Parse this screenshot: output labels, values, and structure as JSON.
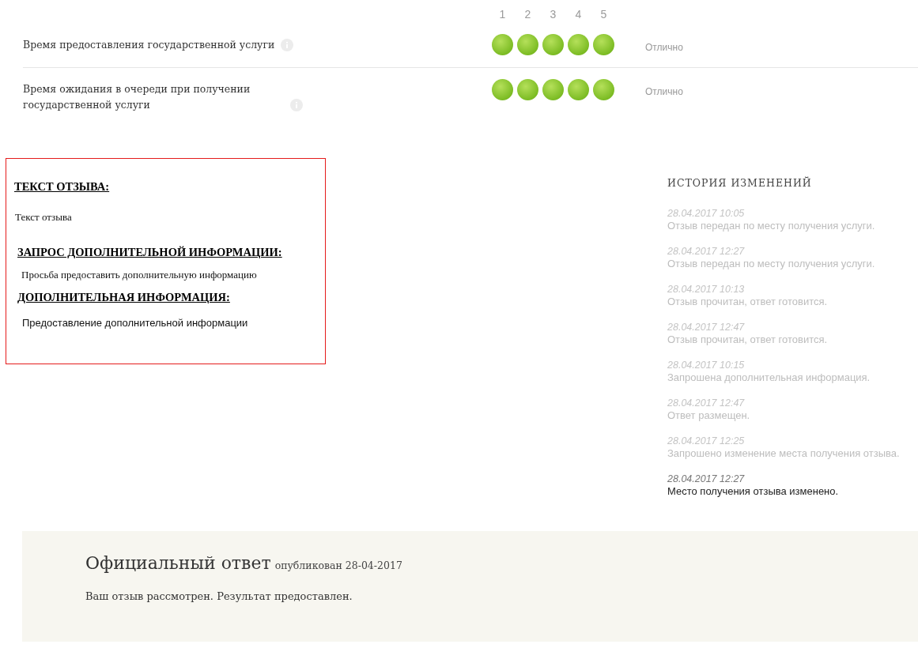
{
  "scale": [
    "1",
    "2",
    "3",
    "4",
    "5"
  ],
  "ratings": [
    {
      "label": "Время предоставления государственной услуги",
      "stars": 5,
      "verdict": "Отлично"
    },
    {
      "label": "Время ожидания в очереди при получении государственной услуги",
      "stars": 5,
      "verdict": "Отлично"
    }
  ],
  "review": {
    "sections": [
      {
        "heading": "ТЕКСТ ОТЗЫВА:",
        "body": "Текст отзыва",
        "kind": "serif"
      },
      {
        "heading": "ЗАПРОС ДОПОЛНИТЕЛЬНОЙ ИНФОРМАЦИИ:",
        "body": "Просьба предоставить дополнительную информацию",
        "kind": "serif"
      },
      {
        "heading": "ДОПОЛНИТЕЛЬНАЯ ИНФОРМАЦИЯ:",
        "body": "Предоставление дополнительной информации",
        "kind": "sans"
      }
    ]
  },
  "history": {
    "title": "ИСТОРИЯ ИЗМЕНЕНИЙ",
    "entries": [
      {
        "time": "28.04.2017 10:05",
        "text": "Отзыв передан по месту получения услуги.",
        "current": false
      },
      {
        "time": "28.04.2017 12:27",
        "text": "Отзыв передан по месту получения услуги.",
        "current": false
      },
      {
        "time": "28.04.2017 10:13",
        "text": "Отзыв прочитан, ответ готовится.",
        "current": false
      },
      {
        "time": "28.04.2017 12:47",
        "text": "Отзыв прочитан, ответ готовится.",
        "current": false
      },
      {
        "time": "28.04.2017 10:15",
        "text": "Запрошена дополнительная информация.",
        "current": false
      },
      {
        "time": "28.04.2017 12:47",
        "text": "Ответ размещен.",
        "current": false
      },
      {
        "time": "28.04.2017 12:25",
        "text": "Запрошено изменение места получения отзыва.",
        "current": false
      },
      {
        "time": "28.04.2017 12:27",
        "text": "Место получения отзыва изменено.",
        "current": true
      }
    ]
  },
  "answer": {
    "title": "Официальный ответ",
    "published": "опубликован 28-04-2017",
    "text": "Ваш отзыв рассмотрен. Результат предоставлен."
  }
}
